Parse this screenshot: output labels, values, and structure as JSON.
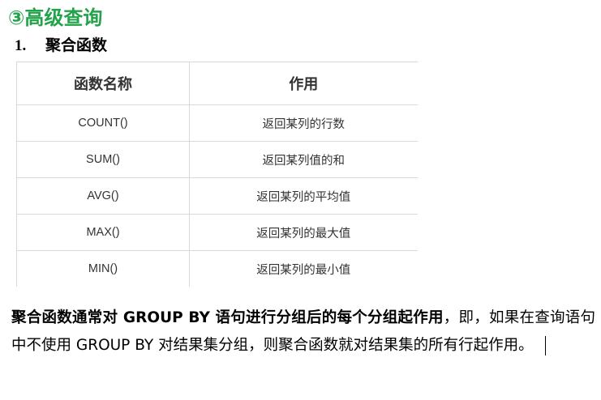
{
  "section_title": "③高级查询",
  "subsection": {
    "number": "1.",
    "title": "聚合函数"
  },
  "table": {
    "headers": [
      "函数名称",
      "作用"
    ],
    "rows": [
      [
        "COUNT()",
        "返回某列的行数"
      ],
      [
        "SUM()",
        "返回某列值的和"
      ],
      [
        "AVG()",
        "返回某列的平均值"
      ],
      [
        "MAX()",
        "返回某列的最大值"
      ],
      [
        "MIN()",
        "返回某列的最小值"
      ]
    ]
  },
  "paragraph": {
    "bold_part": "聚合函数通常对 GROUP BY 语句进行分组后的每个分组起作用",
    "rest": "，即，如果在查询语句中不使用 GROUP BY 对结果集分组，则聚合函数就对结果集的所有行起作用。"
  },
  "colors": {
    "heading_green": "#22a34a",
    "table_border": "#d9d9d9",
    "table_text": "#333333"
  }
}
